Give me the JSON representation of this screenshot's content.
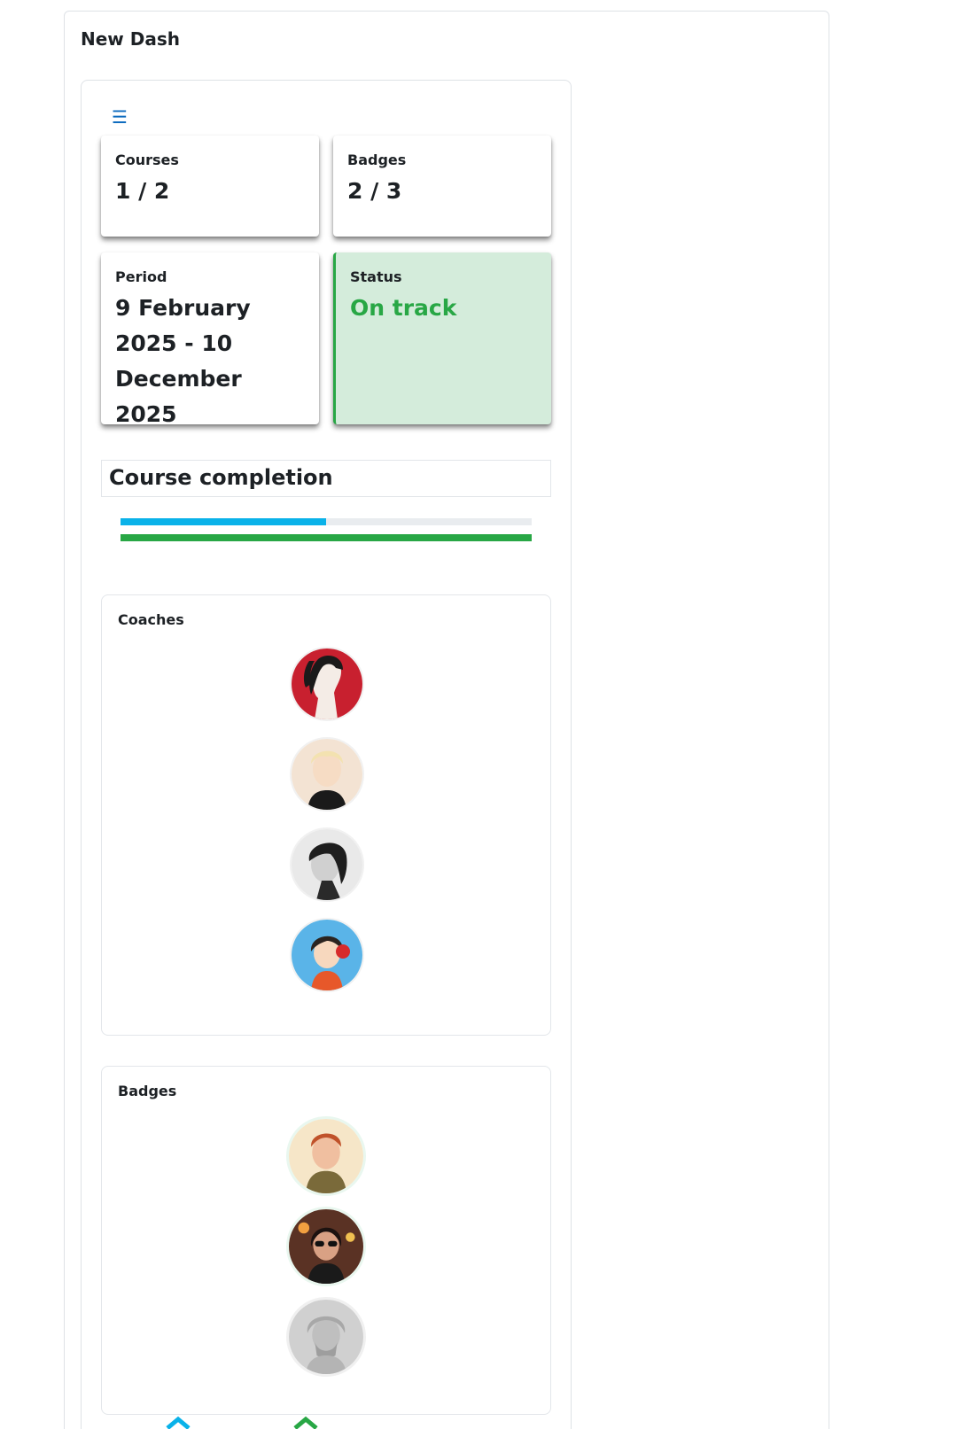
{
  "dashboard": {
    "title": "New Dash"
  },
  "menu": {
    "icon": "hamburger-menu-icon",
    "glyph": "☰"
  },
  "stats": {
    "courses": {
      "label": "Courses",
      "value": "1 / 2"
    },
    "badges": {
      "label": "Badges",
      "value": "2 / 3"
    },
    "period": {
      "label": "Period",
      "value": "9 February 2025 - 10 December 2025"
    },
    "status": {
      "label": "Status",
      "value": "On track",
      "color": "#28a745",
      "background": "#d4ecdb"
    }
  },
  "completion": {
    "title": "Course completion",
    "bars": [
      {
        "progress": 0.5,
        "color": "#0ab2e9"
      },
      {
        "progress": 1.0,
        "color": "#28a745"
      }
    ]
  },
  "coaches": {
    "title": "Coaches",
    "items": [
      {
        "icon": "coach-avatar-1"
      },
      {
        "icon": "coach-avatar-2"
      },
      {
        "icon": "coach-avatar-3"
      },
      {
        "icon": "coach-avatar-4"
      }
    ]
  },
  "badges_section": {
    "title": "Badges",
    "items": [
      {
        "icon": "badge-avatar-1",
        "earned": true
      },
      {
        "icon": "badge-avatar-2",
        "earned": true
      },
      {
        "icon": "badge-avatar-3",
        "earned": false
      }
    ]
  },
  "colors": {
    "accent": "#0f6cbf",
    "success": "#28a745",
    "info": "#0ab2e9"
  }
}
